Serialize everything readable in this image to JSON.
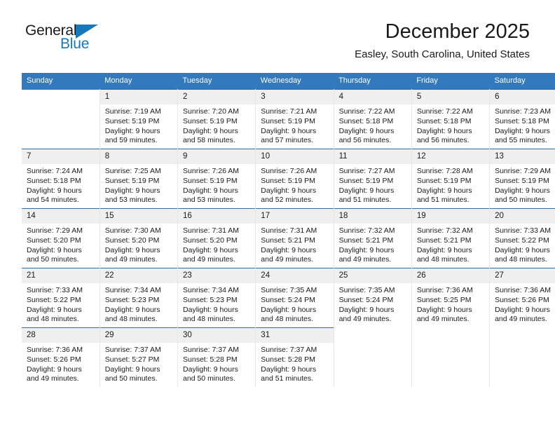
{
  "brand": {
    "name_part1": "General",
    "name_part2": "Blue",
    "triangle_icon": "triangle-icon",
    "accent_color": "#1878be"
  },
  "header": {
    "month_title": "December 2025",
    "location": "Easley, South Carolina, United States"
  },
  "calendar": {
    "header_bg": "#3379bd",
    "row_rule_color": "#2b6cad",
    "daynum_bg": "#efefef",
    "weekday_headers": [
      "Sunday",
      "Monday",
      "Tuesday",
      "Wednesday",
      "Thursday",
      "Friday",
      "Saturday"
    ],
    "weeks": [
      [
        {
          "day": "",
          "sunrise": "",
          "sunset": "",
          "daylight1": "",
          "daylight2": "",
          "empty": true
        },
        {
          "day": "1",
          "sunrise": "Sunrise: 7:19 AM",
          "sunset": "Sunset: 5:19 PM",
          "daylight1": "Daylight: 9 hours",
          "daylight2": "and 59 minutes."
        },
        {
          "day": "2",
          "sunrise": "Sunrise: 7:20 AM",
          "sunset": "Sunset: 5:19 PM",
          "daylight1": "Daylight: 9 hours",
          "daylight2": "and 58 minutes."
        },
        {
          "day": "3",
          "sunrise": "Sunrise: 7:21 AM",
          "sunset": "Sunset: 5:19 PM",
          "daylight1": "Daylight: 9 hours",
          "daylight2": "and 57 minutes."
        },
        {
          "day": "4",
          "sunrise": "Sunrise: 7:22 AM",
          "sunset": "Sunset: 5:18 PM",
          "daylight1": "Daylight: 9 hours",
          "daylight2": "and 56 minutes."
        },
        {
          "day": "5",
          "sunrise": "Sunrise: 7:22 AM",
          "sunset": "Sunset: 5:18 PM",
          "daylight1": "Daylight: 9 hours",
          "daylight2": "and 56 minutes."
        },
        {
          "day": "6",
          "sunrise": "Sunrise: 7:23 AM",
          "sunset": "Sunset: 5:18 PM",
          "daylight1": "Daylight: 9 hours",
          "daylight2": "and 55 minutes."
        }
      ],
      [
        {
          "day": "7",
          "sunrise": "Sunrise: 7:24 AM",
          "sunset": "Sunset: 5:18 PM",
          "daylight1": "Daylight: 9 hours",
          "daylight2": "and 54 minutes."
        },
        {
          "day": "8",
          "sunrise": "Sunrise: 7:25 AM",
          "sunset": "Sunset: 5:19 PM",
          "daylight1": "Daylight: 9 hours",
          "daylight2": "and 53 minutes."
        },
        {
          "day": "9",
          "sunrise": "Sunrise: 7:26 AM",
          "sunset": "Sunset: 5:19 PM",
          "daylight1": "Daylight: 9 hours",
          "daylight2": "and 53 minutes."
        },
        {
          "day": "10",
          "sunrise": "Sunrise: 7:26 AM",
          "sunset": "Sunset: 5:19 PM",
          "daylight1": "Daylight: 9 hours",
          "daylight2": "and 52 minutes."
        },
        {
          "day": "11",
          "sunrise": "Sunrise: 7:27 AM",
          "sunset": "Sunset: 5:19 PM",
          "daylight1": "Daylight: 9 hours",
          "daylight2": "and 51 minutes."
        },
        {
          "day": "12",
          "sunrise": "Sunrise: 7:28 AM",
          "sunset": "Sunset: 5:19 PM",
          "daylight1": "Daylight: 9 hours",
          "daylight2": "and 51 minutes."
        },
        {
          "day": "13",
          "sunrise": "Sunrise: 7:29 AM",
          "sunset": "Sunset: 5:19 PM",
          "daylight1": "Daylight: 9 hours",
          "daylight2": "and 50 minutes."
        }
      ],
      [
        {
          "day": "14",
          "sunrise": "Sunrise: 7:29 AM",
          "sunset": "Sunset: 5:20 PM",
          "daylight1": "Daylight: 9 hours",
          "daylight2": "and 50 minutes."
        },
        {
          "day": "15",
          "sunrise": "Sunrise: 7:30 AM",
          "sunset": "Sunset: 5:20 PM",
          "daylight1": "Daylight: 9 hours",
          "daylight2": "and 49 minutes."
        },
        {
          "day": "16",
          "sunrise": "Sunrise: 7:31 AM",
          "sunset": "Sunset: 5:20 PM",
          "daylight1": "Daylight: 9 hours",
          "daylight2": "and 49 minutes."
        },
        {
          "day": "17",
          "sunrise": "Sunrise: 7:31 AM",
          "sunset": "Sunset: 5:21 PM",
          "daylight1": "Daylight: 9 hours",
          "daylight2": "and 49 minutes."
        },
        {
          "day": "18",
          "sunrise": "Sunrise: 7:32 AM",
          "sunset": "Sunset: 5:21 PM",
          "daylight1": "Daylight: 9 hours",
          "daylight2": "and 49 minutes."
        },
        {
          "day": "19",
          "sunrise": "Sunrise: 7:32 AM",
          "sunset": "Sunset: 5:21 PM",
          "daylight1": "Daylight: 9 hours",
          "daylight2": "and 48 minutes."
        },
        {
          "day": "20",
          "sunrise": "Sunrise: 7:33 AM",
          "sunset": "Sunset: 5:22 PM",
          "daylight1": "Daylight: 9 hours",
          "daylight2": "and 48 minutes."
        }
      ],
      [
        {
          "day": "21",
          "sunrise": "Sunrise: 7:33 AM",
          "sunset": "Sunset: 5:22 PM",
          "daylight1": "Daylight: 9 hours",
          "daylight2": "and 48 minutes."
        },
        {
          "day": "22",
          "sunrise": "Sunrise: 7:34 AM",
          "sunset": "Sunset: 5:23 PM",
          "daylight1": "Daylight: 9 hours",
          "daylight2": "and 48 minutes."
        },
        {
          "day": "23",
          "sunrise": "Sunrise: 7:34 AM",
          "sunset": "Sunset: 5:23 PM",
          "daylight1": "Daylight: 9 hours",
          "daylight2": "and 48 minutes."
        },
        {
          "day": "24",
          "sunrise": "Sunrise: 7:35 AM",
          "sunset": "Sunset: 5:24 PM",
          "daylight1": "Daylight: 9 hours",
          "daylight2": "and 48 minutes."
        },
        {
          "day": "25",
          "sunrise": "Sunrise: 7:35 AM",
          "sunset": "Sunset: 5:24 PM",
          "daylight1": "Daylight: 9 hours",
          "daylight2": "and 49 minutes."
        },
        {
          "day": "26",
          "sunrise": "Sunrise: 7:36 AM",
          "sunset": "Sunset: 5:25 PM",
          "daylight1": "Daylight: 9 hours",
          "daylight2": "and 49 minutes."
        },
        {
          "day": "27",
          "sunrise": "Sunrise: 7:36 AM",
          "sunset": "Sunset: 5:26 PM",
          "daylight1": "Daylight: 9 hours",
          "daylight2": "and 49 minutes."
        }
      ],
      [
        {
          "day": "28",
          "sunrise": "Sunrise: 7:36 AM",
          "sunset": "Sunset: 5:26 PM",
          "daylight1": "Daylight: 9 hours",
          "daylight2": "and 49 minutes."
        },
        {
          "day": "29",
          "sunrise": "Sunrise: 7:37 AM",
          "sunset": "Sunset: 5:27 PM",
          "daylight1": "Daylight: 9 hours",
          "daylight2": "and 50 minutes."
        },
        {
          "day": "30",
          "sunrise": "Sunrise: 7:37 AM",
          "sunset": "Sunset: 5:28 PM",
          "daylight1": "Daylight: 9 hours",
          "daylight2": "and 50 minutes."
        },
        {
          "day": "31",
          "sunrise": "Sunrise: 7:37 AM",
          "sunset": "Sunset: 5:28 PM",
          "daylight1": "Daylight: 9 hours",
          "daylight2": "and 51 minutes."
        },
        {
          "day": "",
          "sunrise": "",
          "sunset": "",
          "daylight1": "",
          "daylight2": "",
          "empty": true
        },
        {
          "day": "",
          "sunrise": "",
          "sunset": "",
          "daylight1": "",
          "daylight2": "",
          "empty": true
        },
        {
          "day": "",
          "sunrise": "",
          "sunset": "",
          "daylight1": "",
          "daylight2": "",
          "empty": true
        }
      ]
    ]
  }
}
